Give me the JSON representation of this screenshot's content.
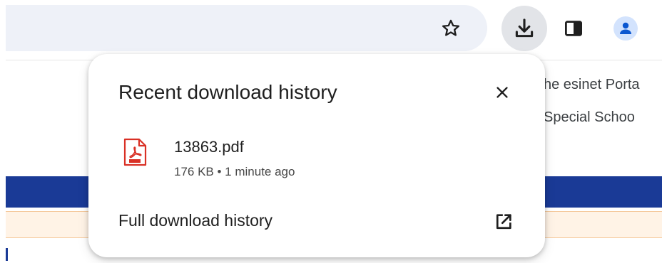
{
  "toolbar": {
    "bookmark_icon": "star-icon",
    "downloads_icon": "download-icon",
    "side_panel_icon": "side-panel-icon",
    "profile_icon": "person-icon",
    "download_button_bg": "#e2e4e8",
    "profile_color": "#0b57d0"
  },
  "background_page": {
    "line1": "he esinet Porta",
    "line2": "Special Schoo",
    "accent_blue": "#1a3a96",
    "accent_peach": "#fff3e6"
  },
  "download_bubble": {
    "title": "Recent download history",
    "close_icon": "close-icon",
    "items": [
      {
        "icon": "pdf-file-icon",
        "name": "13863.pdf",
        "meta": "176 KB • 1 minute ago"
      }
    ],
    "footer_link": "Full download history",
    "footer_icon": "open-in-new-icon"
  }
}
